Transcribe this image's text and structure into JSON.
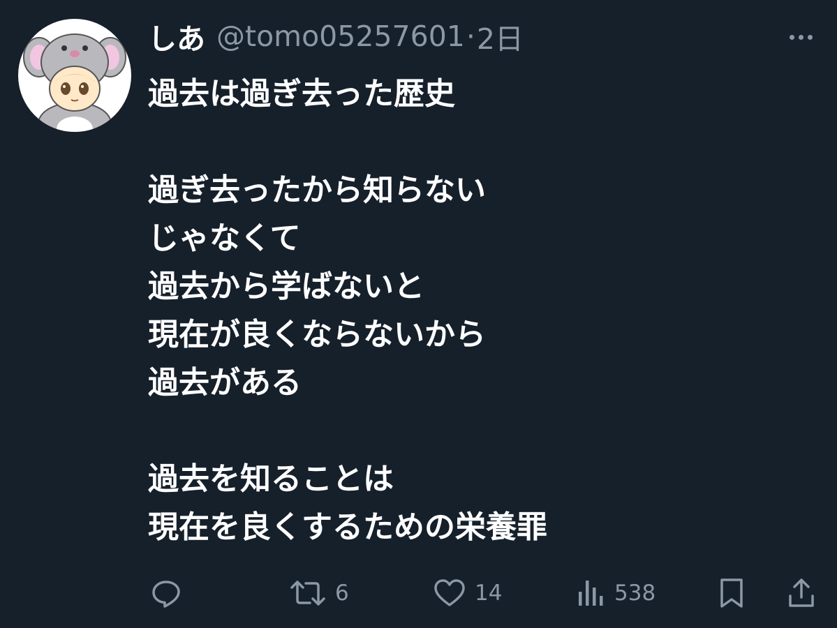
{
  "user": {
    "display_name": "しあ",
    "handle": "@tomo05257601",
    "separator": "·",
    "time": "2日"
  },
  "tweet": {
    "lines": [
      "過去は過ぎ去った歴史",
      "",
      "過ぎ去ったから知らない",
      "じゃなくて",
      "過去から学ばないと",
      "現在が良くならないから",
      "過去がある",
      "",
      "過去を知ることは",
      "現在を良くするための栄養罪"
    ]
  },
  "actions": {
    "reply": {
      "icon": "reply-icon"
    },
    "retweet": {
      "icon": "retweet-icon",
      "count": "6"
    },
    "like": {
      "icon": "heart-icon",
      "count": "14"
    },
    "views": {
      "icon": "views-icon",
      "count": "538"
    },
    "bookmark": {
      "icon": "bookmark-icon"
    },
    "share": {
      "icon": "share-icon"
    }
  },
  "colors": {
    "background": "#16202b",
    "text": "#ffffff",
    "muted": "#8b98a5"
  }
}
